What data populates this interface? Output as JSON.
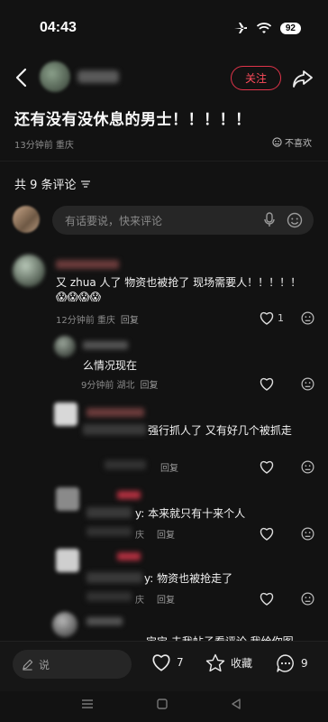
{
  "status_bar": {
    "time": "04:43",
    "battery": "92"
  },
  "header": {
    "follow_label": "关注"
  },
  "post": {
    "title": "还有没有没休息的男士！！！！！",
    "meta": "13分钟前 重庆",
    "dislike_label": "不喜欢"
  },
  "comments_header": {
    "count_label": "共 9 条评论"
  },
  "comment_input": {
    "placeholder": "有话要说，快来评论"
  },
  "comments": [
    {
      "text": "又 zhua 人了 物资也被抢了 现场需要人！！！！！",
      "emoji": "😱😱😱😱",
      "time_location": "12分钟前 重庆",
      "reply": "回复",
      "likes": "1"
    },
    {
      "text": "么情况现在",
      "time_location": "9分钟前 湖北",
      "reply": "回复"
    },
    {
      "text": "强行抓人了 又有好几个被抓走",
      "time_location": "",
      "reply": "回复"
    },
    {
      "text": "y: 本来就只有十来个人",
      "time_location": "庆",
      "reply": "回复"
    },
    {
      "text": "y: 物资也被抢走了",
      "time_location": "庆",
      "reply": "回复"
    },
    {
      "text": "宝宝 去我帖子看评论 我给你图",
      "time_location": "",
      "reply": ""
    }
  ],
  "bottom_bar": {
    "input_label": "说",
    "likes": "7",
    "favorite_label": "收藏",
    "comments": "9"
  },
  "icons": {
    "back": "chevron-left-icon",
    "share": "share-icon",
    "dislike": "dislike-face-icon",
    "filter": "filter-icon",
    "mic": "mic-icon",
    "emoji": "emoji-icon",
    "heart": "heart-icon",
    "star": "star-icon",
    "comment": "comment-icon",
    "pen": "pen-icon"
  },
  "colors": {
    "accent": "#ff4c5c",
    "background": "#121212"
  }
}
